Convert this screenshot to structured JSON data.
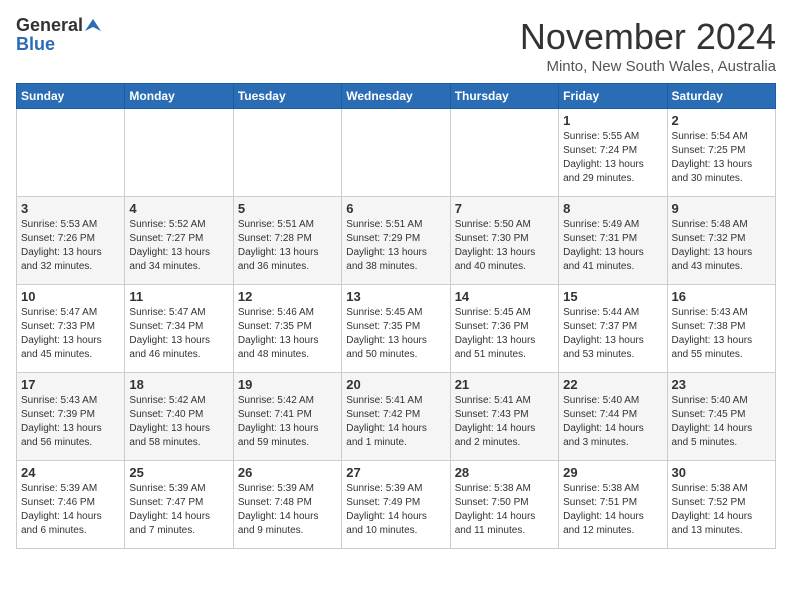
{
  "logo": {
    "general": "General",
    "blue": "Blue"
  },
  "title": "November 2024",
  "subtitle": "Minto, New South Wales, Australia",
  "days_header": [
    "Sunday",
    "Monday",
    "Tuesday",
    "Wednesday",
    "Thursday",
    "Friday",
    "Saturday"
  ],
  "weeks": [
    [
      {
        "day": "",
        "info": ""
      },
      {
        "day": "",
        "info": ""
      },
      {
        "day": "",
        "info": ""
      },
      {
        "day": "",
        "info": ""
      },
      {
        "day": "",
        "info": ""
      },
      {
        "day": "1",
        "info": "Sunrise: 5:55 AM\nSunset: 7:24 PM\nDaylight: 13 hours\nand 29 minutes."
      },
      {
        "day": "2",
        "info": "Sunrise: 5:54 AM\nSunset: 7:25 PM\nDaylight: 13 hours\nand 30 minutes."
      }
    ],
    [
      {
        "day": "3",
        "info": "Sunrise: 5:53 AM\nSunset: 7:26 PM\nDaylight: 13 hours\nand 32 minutes."
      },
      {
        "day": "4",
        "info": "Sunrise: 5:52 AM\nSunset: 7:27 PM\nDaylight: 13 hours\nand 34 minutes."
      },
      {
        "day": "5",
        "info": "Sunrise: 5:51 AM\nSunset: 7:28 PM\nDaylight: 13 hours\nand 36 minutes."
      },
      {
        "day": "6",
        "info": "Sunrise: 5:51 AM\nSunset: 7:29 PM\nDaylight: 13 hours\nand 38 minutes."
      },
      {
        "day": "7",
        "info": "Sunrise: 5:50 AM\nSunset: 7:30 PM\nDaylight: 13 hours\nand 40 minutes."
      },
      {
        "day": "8",
        "info": "Sunrise: 5:49 AM\nSunset: 7:31 PM\nDaylight: 13 hours\nand 41 minutes."
      },
      {
        "day": "9",
        "info": "Sunrise: 5:48 AM\nSunset: 7:32 PM\nDaylight: 13 hours\nand 43 minutes."
      }
    ],
    [
      {
        "day": "10",
        "info": "Sunrise: 5:47 AM\nSunset: 7:33 PM\nDaylight: 13 hours\nand 45 minutes."
      },
      {
        "day": "11",
        "info": "Sunrise: 5:47 AM\nSunset: 7:34 PM\nDaylight: 13 hours\nand 46 minutes."
      },
      {
        "day": "12",
        "info": "Sunrise: 5:46 AM\nSunset: 7:35 PM\nDaylight: 13 hours\nand 48 minutes."
      },
      {
        "day": "13",
        "info": "Sunrise: 5:45 AM\nSunset: 7:35 PM\nDaylight: 13 hours\nand 50 minutes."
      },
      {
        "day": "14",
        "info": "Sunrise: 5:45 AM\nSunset: 7:36 PM\nDaylight: 13 hours\nand 51 minutes."
      },
      {
        "day": "15",
        "info": "Sunrise: 5:44 AM\nSunset: 7:37 PM\nDaylight: 13 hours\nand 53 minutes."
      },
      {
        "day": "16",
        "info": "Sunrise: 5:43 AM\nSunset: 7:38 PM\nDaylight: 13 hours\nand 55 minutes."
      }
    ],
    [
      {
        "day": "17",
        "info": "Sunrise: 5:43 AM\nSunset: 7:39 PM\nDaylight: 13 hours\nand 56 minutes."
      },
      {
        "day": "18",
        "info": "Sunrise: 5:42 AM\nSunset: 7:40 PM\nDaylight: 13 hours\nand 58 minutes."
      },
      {
        "day": "19",
        "info": "Sunrise: 5:42 AM\nSunset: 7:41 PM\nDaylight: 13 hours\nand 59 minutes."
      },
      {
        "day": "20",
        "info": "Sunrise: 5:41 AM\nSunset: 7:42 PM\nDaylight: 14 hours\nand 1 minute."
      },
      {
        "day": "21",
        "info": "Sunrise: 5:41 AM\nSunset: 7:43 PM\nDaylight: 14 hours\nand 2 minutes."
      },
      {
        "day": "22",
        "info": "Sunrise: 5:40 AM\nSunset: 7:44 PM\nDaylight: 14 hours\nand 3 minutes."
      },
      {
        "day": "23",
        "info": "Sunrise: 5:40 AM\nSunset: 7:45 PM\nDaylight: 14 hours\nand 5 minutes."
      }
    ],
    [
      {
        "day": "24",
        "info": "Sunrise: 5:39 AM\nSunset: 7:46 PM\nDaylight: 14 hours\nand 6 minutes."
      },
      {
        "day": "25",
        "info": "Sunrise: 5:39 AM\nSunset: 7:47 PM\nDaylight: 14 hours\nand 7 minutes."
      },
      {
        "day": "26",
        "info": "Sunrise: 5:39 AM\nSunset: 7:48 PM\nDaylight: 14 hours\nand 9 minutes."
      },
      {
        "day": "27",
        "info": "Sunrise: 5:39 AM\nSunset: 7:49 PM\nDaylight: 14 hours\nand 10 minutes."
      },
      {
        "day": "28",
        "info": "Sunrise: 5:38 AM\nSunset: 7:50 PM\nDaylight: 14 hours\nand 11 minutes."
      },
      {
        "day": "29",
        "info": "Sunrise: 5:38 AM\nSunset: 7:51 PM\nDaylight: 14 hours\nand 12 minutes."
      },
      {
        "day": "30",
        "info": "Sunrise: 5:38 AM\nSunset: 7:52 PM\nDaylight: 14 hours\nand 13 minutes."
      }
    ]
  ]
}
